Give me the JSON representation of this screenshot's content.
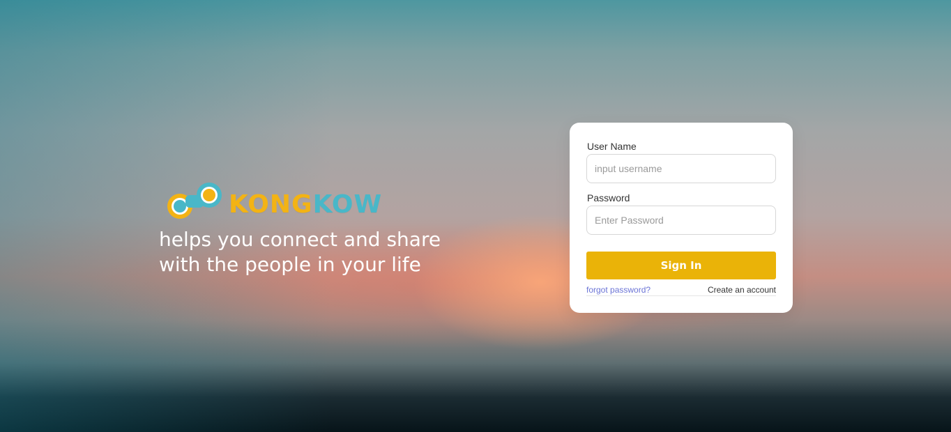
{
  "brand": {
    "wordmark_part1": "KONG",
    "wordmark_part2": "KOW",
    "tagline_line1": "helps you connect and share",
    "tagline_line2": "with the people in your life",
    "colors": {
      "yellow": "#f3b314",
      "teal": "#49b7c8"
    }
  },
  "login": {
    "username_label": "User Name",
    "username_placeholder": "input username",
    "password_label": "Password",
    "password_placeholder": "Enter Password",
    "signin_label": "Sign In",
    "forgot_label": "forgot password?",
    "create_label": "Create an account",
    "button_color": "#eab308"
  }
}
